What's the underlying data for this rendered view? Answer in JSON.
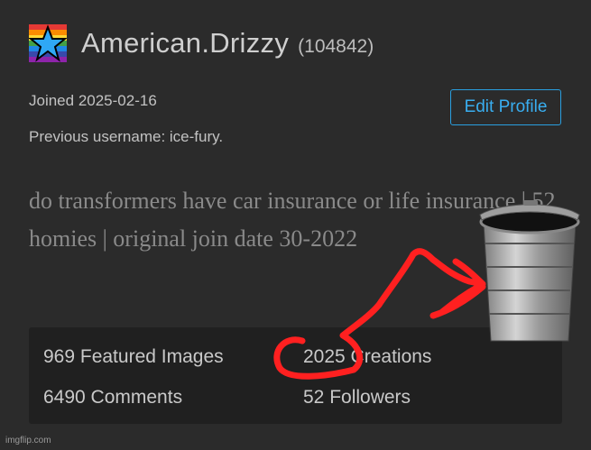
{
  "profile": {
    "username": "American.Drizzy",
    "user_id": "(104842)",
    "joined": "Joined 2025-02-16",
    "previous_username": "Previous username: ice-fury.",
    "edit_button": "Edit Profile",
    "bio": "do transformers have car insurance or life insurance | 52 homies | original join date 30-2022"
  },
  "stats": {
    "featured_images": "969 Featured Images",
    "creations": "2025 Creations",
    "comments": "6490 Comments",
    "followers": "52 Followers"
  },
  "footer": {
    "watermark": "imgflip.com"
  },
  "colors": {
    "background": "#2b2b2b",
    "stats_panel": "#202020",
    "accent": "#2a9fe0",
    "annotation_red": "#ff2020"
  },
  "icons": {
    "avatar": "rainbow-star-icon",
    "overlay": "trash-can-icon"
  }
}
